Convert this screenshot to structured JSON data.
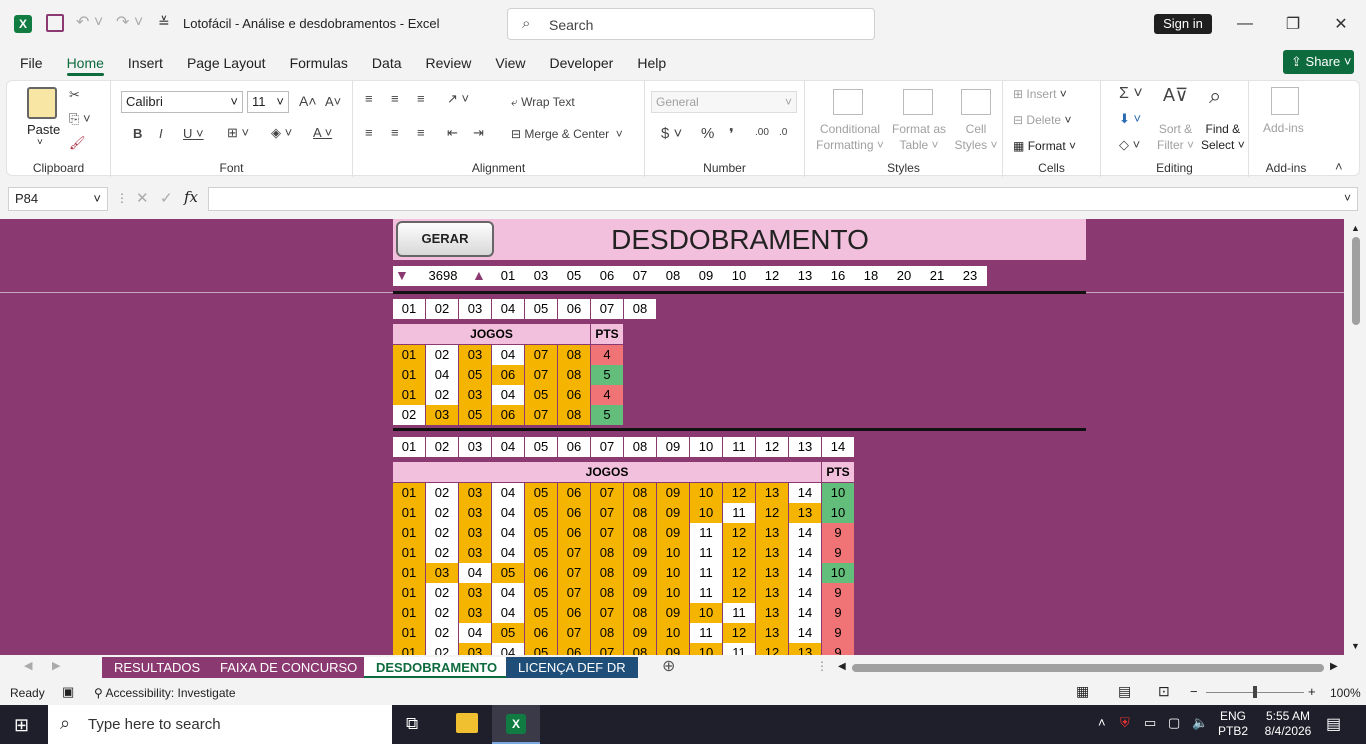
{
  "titlebar": {
    "doc_title": "Lotofácil - Análise e desdobramentos  -  Excel",
    "search_placeholder": "Search",
    "sign_in": "Sign in"
  },
  "ribbon_tabs": [
    "File",
    "Home",
    "Insert",
    "Page Layout",
    "Formulas",
    "Data",
    "Review",
    "View",
    "Developer",
    "Help"
  ],
  "share_label": "Share",
  "clipboard": {
    "paste": "Paste",
    "label": "Clipboard"
  },
  "font": {
    "family": "Calibri",
    "size": "11",
    "label": "Font"
  },
  "alignment": {
    "wrap": "Wrap Text",
    "merge": "Merge & Center",
    "label": "Alignment"
  },
  "number": {
    "format": "General",
    "label": "Number"
  },
  "styles": {
    "conditional_1": "Conditional",
    "conditional_2": "Formatting",
    "format_table_1": "Format as",
    "format_table_2": "Table",
    "cell_styles_1": "Cell",
    "cell_styles_2": "Styles",
    "label": "Styles"
  },
  "cells": {
    "insert": "Insert",
    "delete": "Delete",
    "format": "Format",
    "label": "Cells"
  },
  "editing": {
    "sort_1": "Sort &",
    "sort_2": "Filter",
    "find_1": "Find &",
    "find_2": "Select",
    "label": "Editing"
  },
  "addins": {
    "name": "Add-ins",
    "label": "Add-ins"
  },
  "formula": {
    "name_box": "P84",
    "fx": "fx",
    "value": ""
  },
  "sheet": {
    "button": "GERAR",
    "title": "DESDOBRAMENTO",
    "counter": "3698",
    "selected_numbers": [
      "01",
      "03",
      "05",
      "06",
      "07",
      "08",
      "09",
      "10",
      "12",
      "13",
      "16",
      "18",
      "20",
      "21",
      "23"
    ],
    "block1": {
      "header": [
        "01",
        "02",
        "03",
        "04",
        "05",
        "06",
        "07",
        "08"
      ],
      "jogos_label": "JOGOS",
      "pts_label": "PTS",
      "rows": [
        {
          "nums": [
            "01",
            "02",
            "03",
            "04",
            "07",
            "08"
          ],
          "hl": [
            1,
            0,
            1,
            0,
            1,
            1
          ],
          "pts": "4"
        },
        {
          "nums": [
            "01",
            "04",
            "05",
            "06",
            "07",
            "08"
          ],
          "hl": [
            1,
            0,
            1,
            1,
            1,
            1
          ],
          "pts": "5"
        },
        {
          "nums": [
            "01",
            "02",
            "03",
            "04",
            "05",
            "06"
          ],
          "hl": [
            1,
            0,
            1,
            0,
            1,
            1
          ],
          "pts": "4"
        },
        {
          "nums": [
            "02",
            "03",
            "05",
            "06",
            "07",
            "08"
          ],
          "hl": [
            0,
            1,
            1,
            1,
            1,
            1
          ],
          "pts": "5"
        }
      ]
    },
    "block2": {
      "header": [
        "01",
        "02",
        "03",
        "04",
        "05",
        "06",
        "07",
        "08",
        "09",
        "10",
        "11",
        "12",
        "13",
        "14"
      ],
      "jogos_label": "JOGOS",
      "pts_label": "PTS",
      "rows": [
        {
          "nums": [
            "01",
            "02",
            "03",
            "04",
            "05",
            "06",
            "07",
            "08",
            "09",
            "10",
            "12",
            "13",
            "14"
          ],
          "hl": [
            1,
            0,
            1,
            0,
            1,
            1,
            1,
            1,
            1,
            1,
            1,
            1,
            0
          ],
          "pts": "10"
        },
        {
          "nums": [
            "01",
            "02",
            "03",
            "04",
            "05",
            "06",
            "07",
            "08",
            "09",
            "10",
            "11",
            "12",
            "13"
          ],
          "hl": [
            1,
            0,
            1,
            0,
            1,
            1,
            1,
            1,
            1,
            1,
            0,
            1,
            1
          ],
          "pts": "10"
        },
        {
          "nums": [
            "01",
            "02",
            "03",
            "04",
            "05",
            "06",
            "07",
            "08",
            "09",
            "11",
            "12",
            "13",
            "14"
          ],
          "hl": [
            1,
            0,
            1,
            0,
            1,
            1,
            1,
            1,
            1,
            0,
            1,
            1,
            0
          ],
          "pts": "9"
        },
        {
          "nums": [
            "01",
            "02",
            "03",
            "04",
            "05",
            "07",
            "08",
            "09",
            "10",
            "11",
            "12",
            "13",
            "14"
          ],
          "hl": [
            1,
            0,
            1,
            0,
            1,
            1,
            1,
            1,
            1,
            0,
            1,
            1,
            0
          ],
          "pts": "9"
        },
        {
          "nums": [
            "01",
            "03",
            "04",
            "05",
            "06",
            "07",
            "08",
            "09",
            "10",
            "11",
            "12",
            "13",
            "14"
          ],
          "hl": [
            1,
            1,
            0,
            1,
            1,
            1,
            1,
            1,
            1,
            0,
            1,
            1,
            0
          ],
          "pts": "10"
        },
        {
          "nums": [
            "01",
            "02",
            "03",
            "04",
            "05",
            "07",
            "08",
            "09",
            "10",
            "11",
            "12",
            "13",
            "14"
          ],
          "hl": [
            1,
            0,
            1,
            0,
            1,
            1,
            1,
            1,
            1,
            0,
            1,
            1,
            0
          ],
          "pts": "9"
        },
        {
          "nums": [
            "01",
            "02",
            "03",
            "04",
            "05",
            "06",
            "07",
            "08",
            "09",
            "10",
            "11",
            "13",
            "14"
          ],
          "hl": [
            1,
            0,
            1,
            0,
            1,
            1,
            1,
            1,
            1,
            1,
            0,
            1,
            0
          ],
          "pts": "9"
        },
        {
          "nums": [
            "01",
            "02",
            "04",
            "05",
            "06",
            "07",
            "08",
            "09",
            "10",
            "11",
            "12",
            "13",
            "14"
          ],
          "hl": [
            1,
            0,
            0,
            1,
            1,
            1,
            1,
            1,
            1,
            0,
            1,
            1,
            0
          ],
          "pts": "9"
        },
        {
          "nums": [
            "01",
            "02",
            "03",
            "04",
            "05",
            "06",
            "07",
            "08",
            "09",
            "10",
            "11",
            "12",
            "13"
          ],
          "hl": [
            1,
            0,
            1,
            0,
            1,
            1,
            1,
            1,
            1,
            1,
            0,
            1,
            1
          ],
          "pts": "9"
        }
      ]
    }
  },
  "sheet_tabs": [
    "RESULTADOS",
    "FAIXA DE CONCURSO",
    "DESDOBRAMENTO",
    "LICENÇA DEF DR"
  ],
  "active_sheet": "DESDOBRAMENTO",
  "status": {
    "ready": "Ready",
    "accessibility": "Accessibility: Investigate",
    "zoom": "100%"
  },
  "taskbar": {
    "search_placeholder": "Type here to search",
    "lang_1": "ENG",
    "lang_2": "PTB2",
    "time": "5:55 AM",
    "date": "8/4/2026"
  },
  "colors": {
    "grid_bg": "#8b3a71",
    "highlight": "#f5b400",
    "pink": "#f2c0dc",
    "red": "#f07475",
    "green": "#63be7b",
    "excel_green": "#0e6b3e"
  }
}
